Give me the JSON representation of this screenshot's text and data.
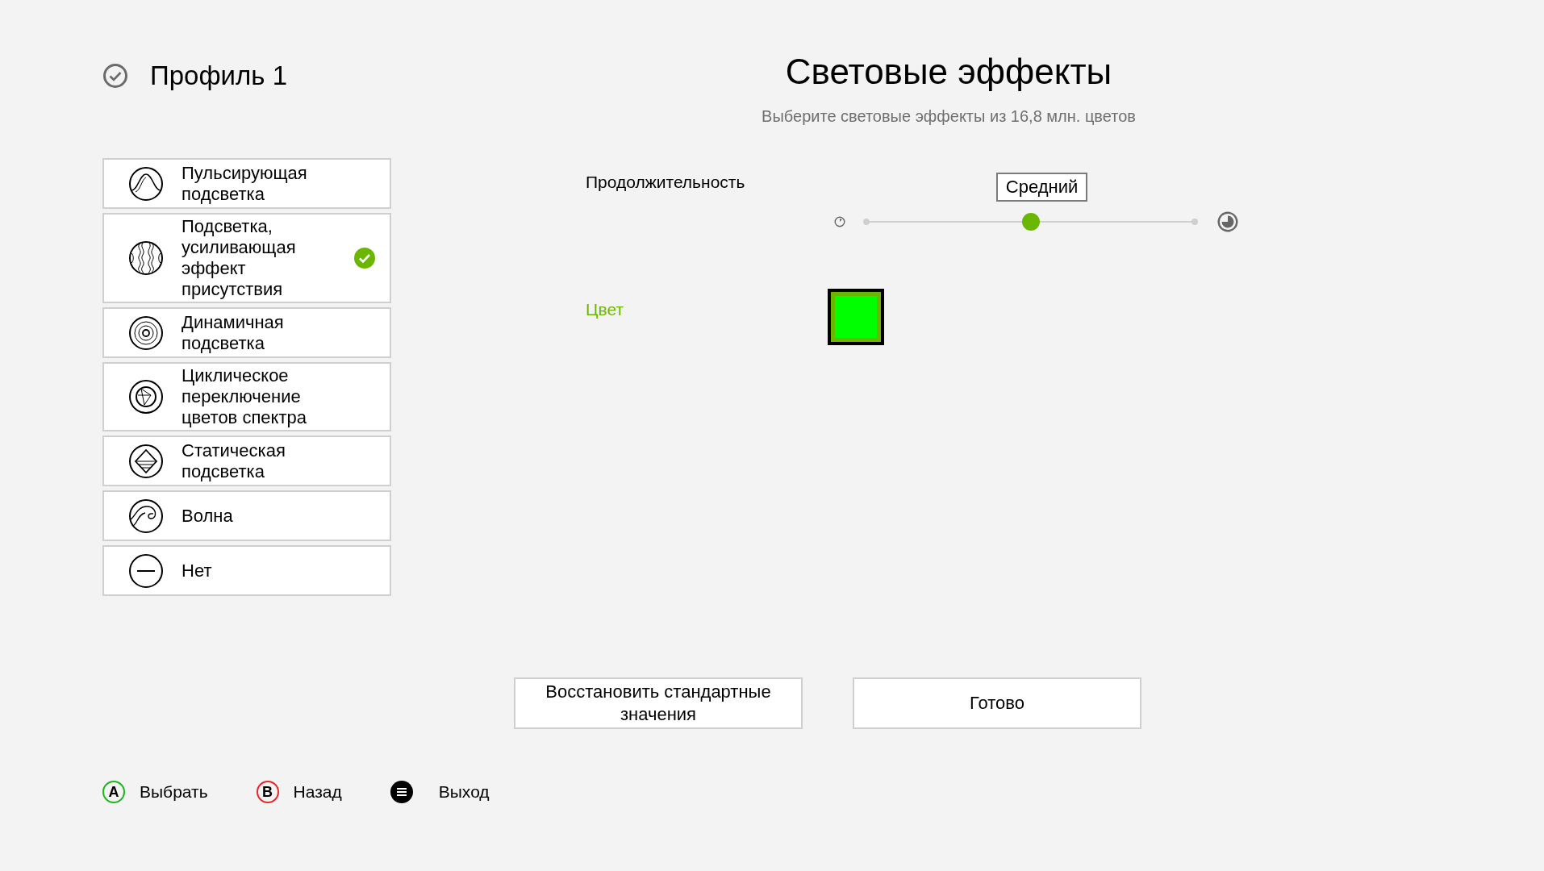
{
  "profile": {
    "title": "Профиль 1"
  },
  "effects": [
    {
      "kind": "pulse",
      "label": "Пульсирующая подсветка",
      "selected": false
    },
    {
      "kind": "presence",
      "label": "Подсветка, усиливающая эффект присутствия",
      "selected": true
    },
    {
      "kind": "dynamic",
      "label": "Динамичная подсветка",
      "selected": false
    },
    {
      "kind": "spectrum",
      "label": "Циклическое переключение цветов спектра",
      "selected": false
    },
    {
      "kind": "static",
      "label": "Статическая подсветка",
      "selected": false
    },
    {
      "kind": "wave",
      "label": "Волна",
      "selected": false
    },
    {
      "kind": "none",
      "label": "Нет",
      "selected": false
    }
  ],
  "heading": "Световые эффекты",
  "subtitle": "Выберите световые эффекты из 16,8 млн. цветов",
  "duration": {
    "label": "Продолжительность",
    "value": "Средний",
    "level": 0.5
  },
  "color": {
    "label": "Цвет",
    "color": "#00ff00"
  },
  "buttons": [
    "Восстановить стандартные значения",
    "Готово"
  ],
  "footer": [
    {
      "kind": "a",
      "key": "A",
      "label": "Выбрать"
    },
    {
      "kind": "b",
      "key": "B",
      "label": "Назад"
    },
    {
      "kind": "menu",
      "label": "Выход"
    }
  ]
}
